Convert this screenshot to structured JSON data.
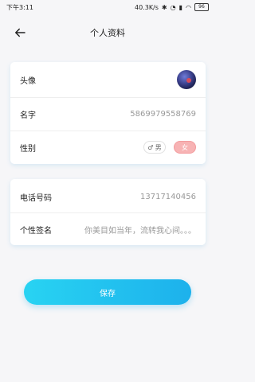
{
  "status": {
    "time": "下午3:11",
    "net_speed": "40.3K/s",
    "battery": "96"
  },
  "nav": {
    "title": "个人资料"
  },
  "profile": {
    "avatar_label": "头像",
    "name_label": "名字",
    "name_value": "5869979558769",
    "gender_label": "性别",
    "gender_options": {
      "male": "男",
      "female": "女"
    },
    "selected_gender": "女"
  },
  "contact": {
    "phone_label": "电话号码",
    "phone_value": "13717140456",
    "signature_label": "个性签名",
    "signature_placeholder": "你美目如当年，流转我心间。。。"
  },
  "actions": {
    "save_label": "保存"
  },
  "colors": {
    "accent_start": "#28d3f2",
    "accent_end": "#1db1ec",
    "female_pill": "#f7b3b4"
  }
}
